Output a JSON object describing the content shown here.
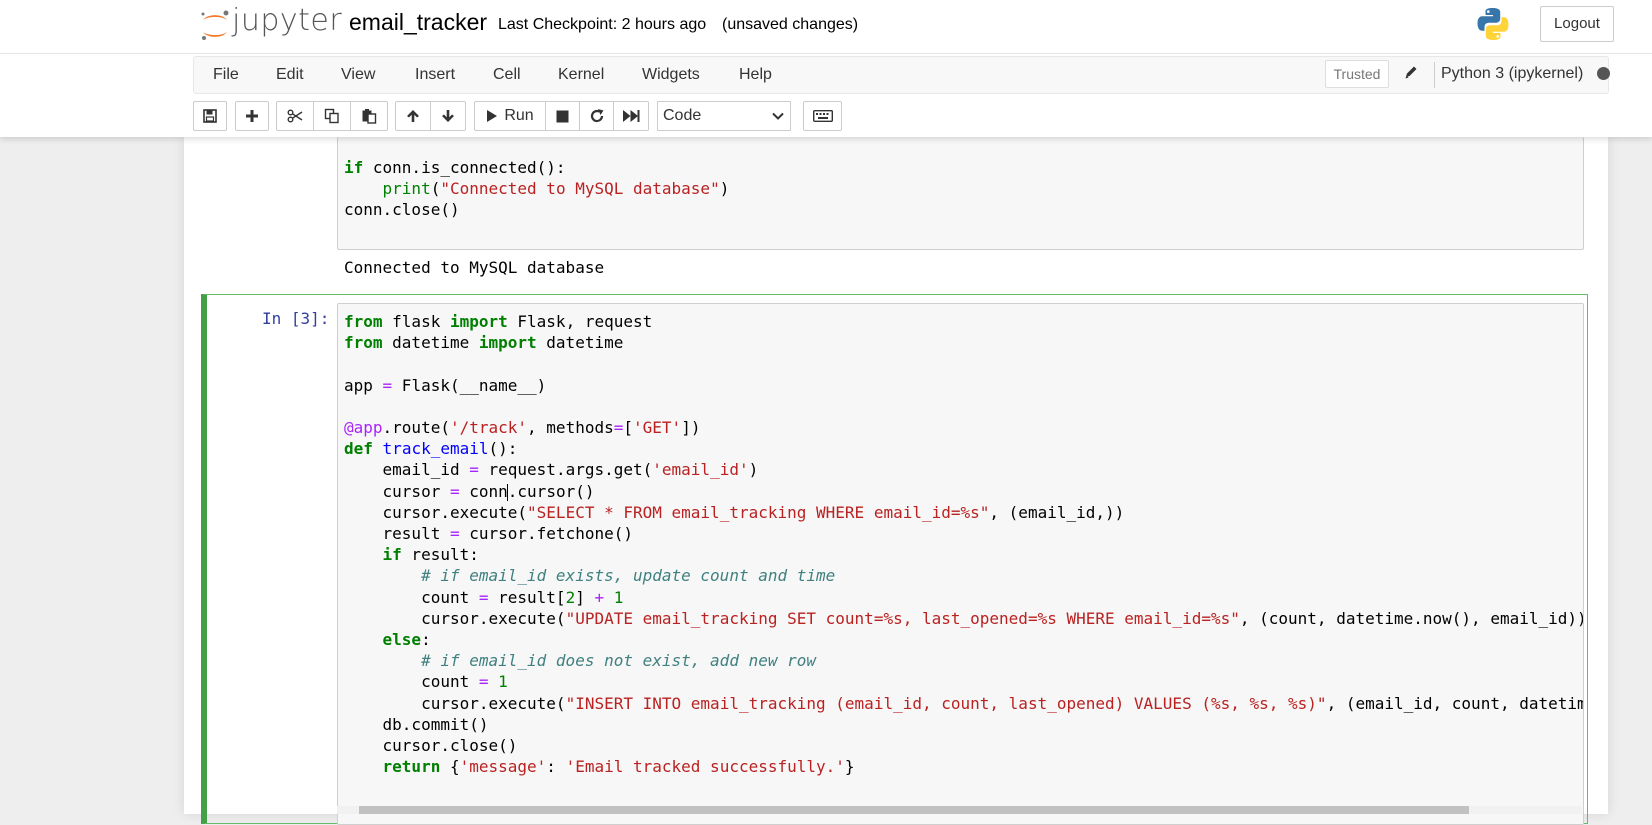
{
  "header": {
    "logo_text": "jupyter",
    "notebook_name": "email_tracker",
    "checkpoint": "Last Checkpoint: 2 hours ago",
    "unsaved": "(unsaved changes)",
    "logout_label": "Logout"
  },
  "menu": {
    "items": [
      "File",
      "Edit",
      "View",
      "Insert",
      "Cell",
      "Kernel",
      "Widgets",
      "Help"
    ],
    "trusted": "Trusted",
    "kernel_name": "Python 3 (ipykernel)"
  },
  "toolbar": {
    "run_label": "Run",
    "cell_type": "Code",
    "icons": [
      "save-icon",
      "plus-icon",
      "cut-icon",
      "copy-icon",
      "paste-icon",
      "arrow-up-icon",
      "arrow-down-icon",
      "play-icon",
      "stop-icon",
      "restart-icon",
      "fast-forward-icon",
      "keyboard-icon"
    ]
  },
  "cell1": {
    "lines": [
      "if conn.is_connected():",
      "    print(\"Connected to MySQL database\")",
      "conn.close()"
    ],
    "output": "Connected to MySQL database"
  },
  "cell2": {
    "prompt": "In [3]:",
    "lines": [
      "from flask import Flask, request",
      "from datetime import datetime",
      "",
      "app = Flask(__name__)",
      "",
      "@app.route('/track', methods=['GET'])",
      "def track_email():",
      "    email_id = request.args.get('email_id')",
      "    cursor = conn.cursor()",
      "    cursor.execute(\"SELECT * FROM email_tracking WHERE email_id=%s\", (email_id,))",
      "    result = cursor.fetchone()",
      "    if result:",
      "        # if email_id exists, update count and time",
      "        count = result[2] + 1",
      "        cursor.execute(\"UPDATE email_tracking SET count=%s, last_opened=%s WHERE email_id=%s\", (count, datetime.now(), email_id))",
      "    else:",
      "        # if email_id does not exist, add new row",
      "        count = 1",
      "        cursor.execute(\"INSERT INTO email_tracking (email_id, count, last_opened) VALUES (%s, %s, %s)\", (email_id, count, datetim",
      "    db.commit()",
      "    cursor.close()",
      "    return {'message': 'Email tracked successfully.'}"
    ]
  }
}
